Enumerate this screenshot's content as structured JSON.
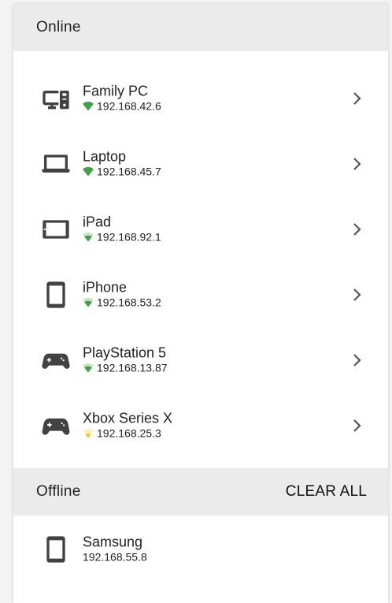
{
  "online": {
    "title": "Online",
    "devices": [
      {
        "name": "Family PC",
        "ip": "192.168.42.6",
        "icon": "desktop-icon",
        "signal": "strong"
      },
      {
        "name": "Laptop",
        "ip": "192.168.45.7",
        "icon": "laptop-icon",
        "signal": "strong"
      },
      {
        "name": "iPad",
        "ip": "192.168.92.1",
        "icon": "tablet-icon",
        "signal": "medium"
      },
      {
        "name": "iPhone",
        "ip": "192.168.53.2",
        "icon": "phone-icon",
        "signal": "medium"
      },
      {
        "name": "PlayStation 5",
        "ip": "192.168.13.87",
        "icon": "gamepad-icon",
        "signal": "medium"
      },
      {
        "name": "Xbox Series X",
        "ip": "192.168.25.3",
        "icon": "gamepad-icon",
        "signal": "weak"
      }
    ]
  },
  "offline": {
    "title": "Offline",
    "clear_label": "CLEAR ALL",
    "devices": [
      {
        "name": "Samsung",
        "ip": "192.168.55.8",
        "icon": "phone-icon"
      }
    ]
  },
  "colors": {
    "signal_good": "#4caf50",
    "signal_weak": "#fdd835",
    "icon": "#424242",
    "header_bg": "#ebebeb"
  }
}
